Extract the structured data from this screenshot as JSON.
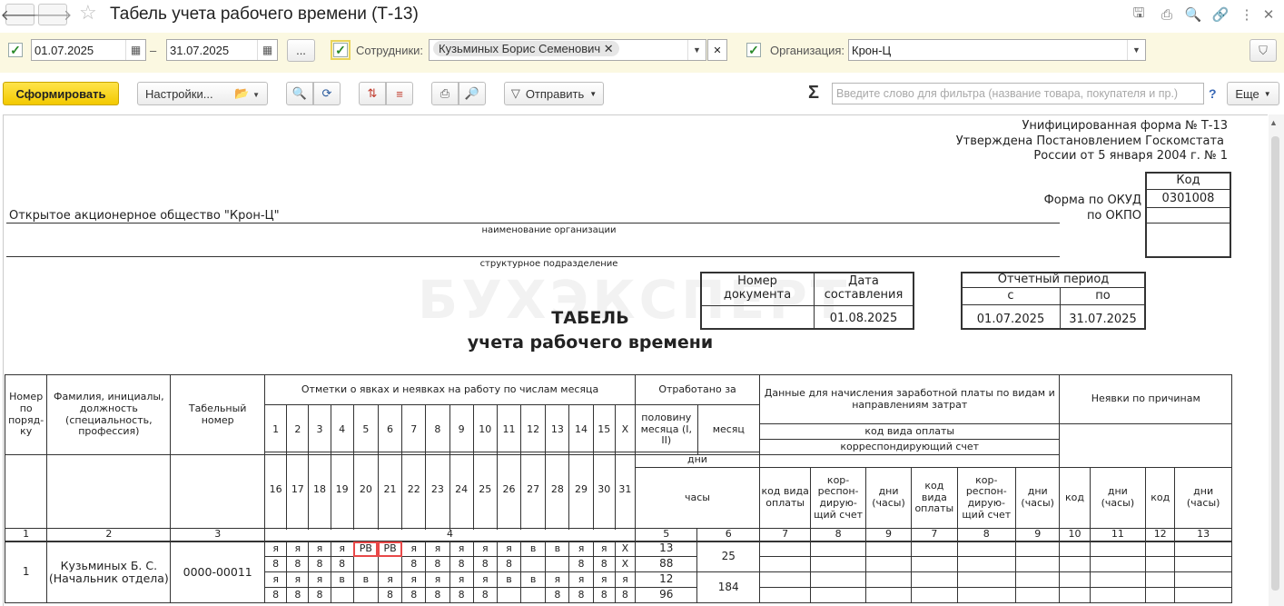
{
  "window": {
    "title": "Табель учета рабочего времени (Т-13)",
    "nav_back_icon": "arrow-left-icon",
    "nav_forward_icon": "arrow-right-icon",
    "star_icon": "star-icon"
  },
  "filters": {
    "date_from": "01.07.2025",
    "date_to": "31.07.2025",
    "dash": "–",
    "more_label": "...",
    "employees_label": "Сотрудники:",
    "employee_tag": "Кузьминых Борис Семенович",
    "organization_label": "Организация:",
    "organization_value": "Крон-Ц"
  },
  "toolbar": {
    "generate_label": "Сформировать",
    "settings_label": "Настройки...",
    "send_label": "Отправить",
    "search_placeholder": "Введите слово для фильтра (название товара, покупателя и пр.)",
    "help_label": "?",
    "more_label": "Еще"
  },
  "report": {
    "form_header": [
      "Унифицированная форма № Т-13",
      "Утверждена Постановлением Госкомстата",
      "России от 5 января 2004 г. № 1"
    ],
    "code_label": "Код",
    "okud_label": "Форма по ОКУД",
    "okud_code": "0301008",
    "okpo_label": "по ОКПО",
    "org_name": "Открытое акционерное общество \"Крон-Ц\"",
    "org_caption": "наименование организации",
    "dept_caption": "структурное подразделение",
    "doc_number_label": "Номер документа",
    "doc_date_label": "Дата составления",
    "doc_number": "",
    "doc_date": "01.08.2025",
    "period_label": "Отчетный период",
    "period_from_label": "с",
    "period_to_label": "по",
    "period_from": "01.07.2025",
    "period_to": "31.07.2025",
    "title": "ТАБЕЛЬ",
    "subtitle": "учета  рабочего времени",
    "watermark": "БУХЭКСПЕРТ"
  },
  "table": {
    "h_num": "Номер по поряд-ку",
    "h_name": "Фамилия, инициалы, должность (специальность, профессия)",
    "h_tab": "Табельный номер",
    "h_marks": "Отметки о явках и неявках на работу по числам месяца",
    "days_row1": [
      "1",
      "2",
      "3",
      "4",
      "5",
      "6",
      "7",
      "8",
      "9",
      "10",
      "11",
      "12",
      "13",
      "14",
      "15",
      "X"
    ],
    "days_row2": [
      "16",
      "17",
      "18",
      "19",
      "20",
      "21",
      "22",
      "23",
      "24",
      "25",
      "26",
      "27",
      "28",
      "29",
      "30",
      "31"
    ],
    "h_worked": "Отработано за",
    "h_half": "половину месяца (I, II)",
    "h_month": "месяц",
    "h_days": "дни",
    "h_hours": "часы",
    "h_pay": "Данные для начисления заработной платы по видам и направлениям затрат",
    "h_pay_code": "код вида оплаты",
    "h_corr": "корреспондирующий счет",
    "h_code_type": "код вида оплаты",
    "h_corr_acc": "кор-респон-дирую-щий счет",
    "h_days_hours": "дни (часы)",
    "h_absence": "Неявки по причинам",
    "h_code": "код",
    "col_numbers": [
      "1",
      "2",
      "3",
      "4",
      "5",
      "6",
      "7",
      "8",
      "9",
      "7",
      "8",
      "9",
      "10",
      "11",
      "12",
      "13"
    ],
    "row": {
      "num": "1",
      "name": "Кузьминых Б. С. (Начальник отдела)",
      "tab": "0000-00011",
      "line1": [
        "я",
        "я",
        "я",
        "я",
        "РВ",
        "РВ",
        "я",
        "я",
        "я",
        "я",
        "я",
        "в",
        "в",
        "я",
        "я",
        "X"
      ],
      "line2": [
        "8",
        "8",
        "8",
        "8",
        "",
        "",
        "8",
        "8",
        "8",
        "8",
        "8",
        "",
        "",
        "8",
        "8",
        "X"
      ],
      "line3": [
        "я",
        "я",
        "я",
        "в",
        "в",
        "я",
        "я",
        "я",
        "я",
        "я",
        "в",
        "в",
        "я",
        "я",
        "я",
        "я"
      ],
      "line4": [
        "8",
        "8",
        "8",
        "",
        "",
        "8",
        "8",
        "8",
        "8",
        "8",
        "",
        "",
        "8",
        "8",
        "8",
        "8"
      ],
      "half1_days": "13",
      "half1_hours": "88",
      "half2_days": "12",
      "half2_hours": "96",
      "month_days": "25",
      "month_hours": "184"
    }
  }
}
